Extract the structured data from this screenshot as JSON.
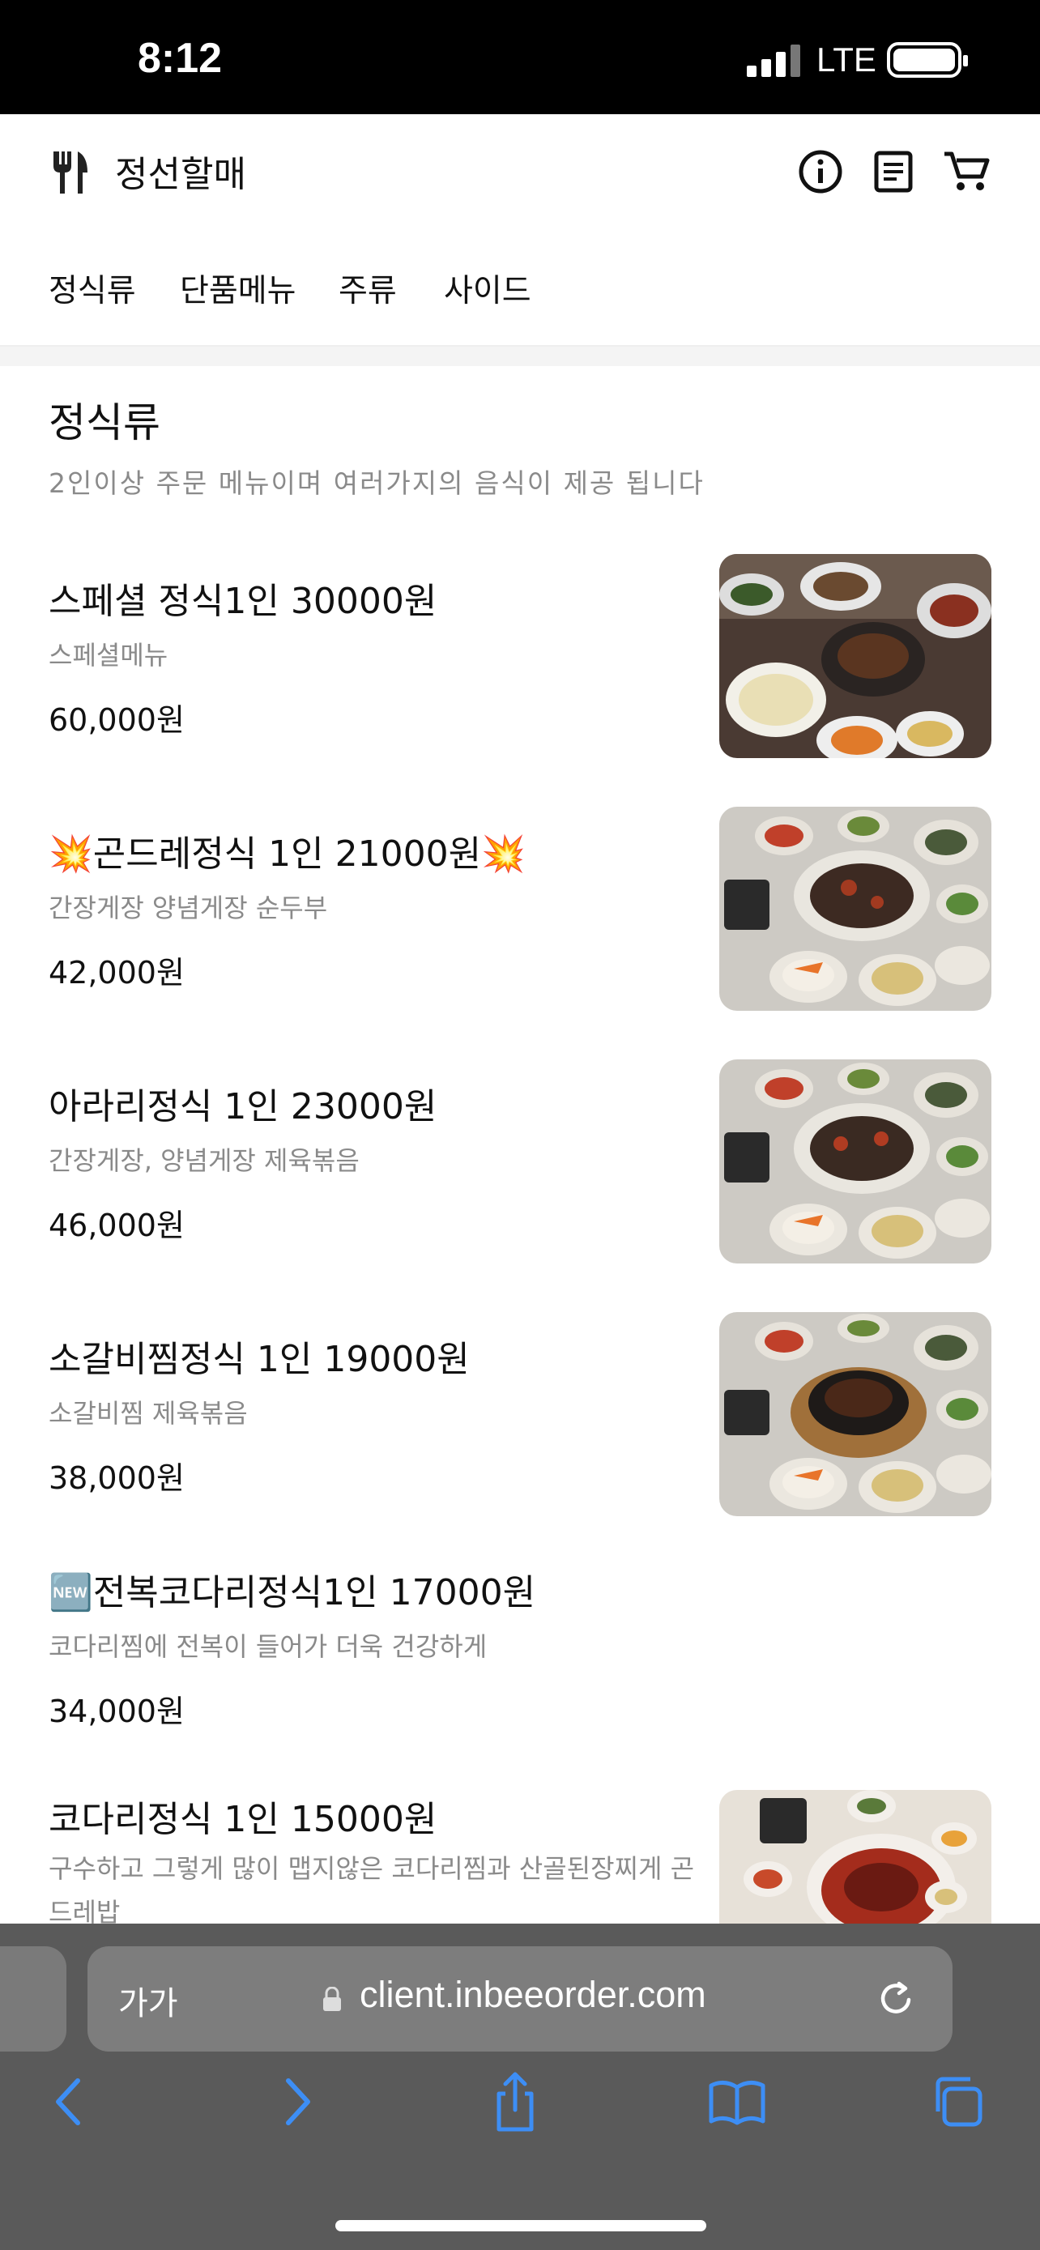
{
  "status_bar": {
    "time": "8:12",
    "network": "LTE"
  },
  "header": {
    "store_name": "정선할매"
  },
  "tabs": [
    {
      "label": "정식류"
    },
    {
      "label": "단품메뉴"
    },
    {
      "label": "주류"
    },
    {
      "label": "사이드"
    }
  ],
  "section": {
    "title": "정식류",
    "description": "2인이상 주문 메뉴이며 여러가지의 음식이 제공 됩니다"
  },
  "items": [
    {
      "name": "스페셜 정식1인 30000원",
      "desc": "스페셜메뉴",
      "price": "60,000원"
    },
    {
      "name": "💥곤드레정식 1인 21000원💥",
      "desc": "간장게장 양념게장 순두부",
      "price": "42,000원"
    },
    {
      "name": "아라리정식 1인 23000원",
      "desc": "간장게장, 양념게장 제육볶음",
      "price": "46,000원"
    },
    {
      "name": "소갈비찜정식 1인 19000원",
      "desc": "소갈비찜 제육볶음",
      "price": "38,000원"
    },
    {
      "name": "🆕전복코다리정식1인 17000원",
      "desc": "코다리찜에 전복이 들어가 더욱 건강하게",
      "price": "34,000원"
    },
    {
      "name": "코다리정식 1인 15000원",
      "desc": "구수하고 그렇게 많이 맵지않은 코다리찜과 산골된장찌게 곤드레밥",
      "price": ""
    }
  ],
  "browser": {
    "aa": "가가",
    "url": "client.inbeeorder.com"
  },
  "icons": [
    "utensils-icon",
    "info-icon",
    "receipt-icon",
    "cart-icon",
    "lock-icon",
    "reload-icon",
    "back-icon",
    "forward-icon",
    "share-icon",
    "bookmarks-icon",
    "tabs-icon"
  ]
}
